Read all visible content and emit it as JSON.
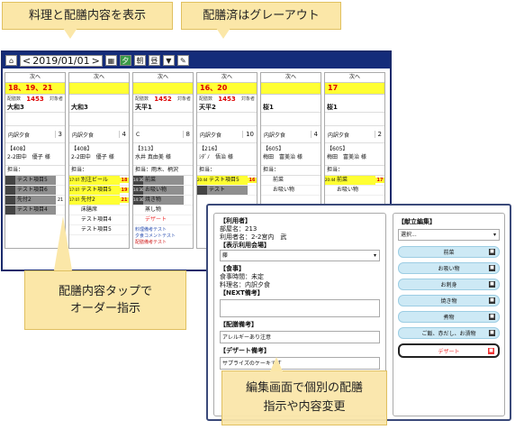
{
  "callouts": {
    "top_left": "料理と配膳内容を表示",
    "top_right": "配膳済はグレーアウト",
    "bottom_left": "配膳内容タップで\nオーダー指示",
    "bottom_right": "編集画面で個別の配膳\n指示や内容変更"
  },
  "toolbar": {
    "home": "⌂",
    "prev": "<",
    "date": "2019/01/01",
    "next": ">",
    "calendar": "▦",
    "btn1": "夕",
    "btn2": "朝",
    "btn3": "昼",
    "filter": "▼",
    "edit": "✎"
  },
  "columns": [
    {
      "next": "次へ",
      "time": "18、19、21",
      "stat_l": "配膳数",
      "num": "1453",
      "stat_r": "対象者",
      "room": "大和3",
      "meal": "内訳夕食",
      "count": "3",
      "inner": "【408】\n2-2田中　優子 様",
      "staff": "担当：",
      "items": [
        {
          "t": "",
          "x": "テスト項目5",
          "q": "",
          "s": "grey"
        },
        {
          "t": "",
          "x": "テスト項目6",
          "q": "",
          "s": "grey"
        },
        {
          "t": "",
          "x": "先付2",
          "q": "21",
          "s": "grey"
        },
        {
          "t": "",
          "x": "テスト項目4",
          "q": "",
          "s": "grey"
        }
      ],
      "notes": []
    },
    {
      "next": "次へ",
      "time": "",
      "stat_l": "",
      "num": "",
      "stat_r": "",
      "room": "大和3",
      "meal": "内訳夕食",
      "count": "4",
      "inner": "【408】\n2-2田中　優子 様",
      "staff": "担当：",
      "items": [
        {
          "t": "17:07",
          "x": "別注ビール",
          "q": "18",
          "s": "yel"
        },
        {
          "t": "17:07",
          "x": "テスト項目5",
          "q": "19",
          "s": "yel"
        },
        {
          "t": "17:07",
          "x": "先付2",
          "q": "21",
          "s": "yel"
        },
        {
          "t": "",
          "x": "床膳席",
          "q": "",
          "s": ""
        },
        {
          "t": "",
          "x": "テスト項目4",
          "q": "",
          "s": ""
        },
        {
          "t": "",
          "x": "テスト項目5",
          "q": "",
          "s": ""
        }
      ],
      "notes": []
    },
    {
      "next": "次へ",
      "time": "",
      "stat_l": "配膳数",
      "num": "1452",
      "stat_r": "対象者",
      "room": "天平1",
      "meal": "C",
      "count": "8",
      "inner": "【313】\n水井 真由美 様",
      "staff": "担当：雨木、柄沢",
      "items": [
        {
          "t": "14:30",
          "x": "前菜",
          "q": "",
          "s": "grey"
        },
        {
          "t": "14:30",
          "x": "お吸い物",
          "q": "",
          "s": "grey"
        },
        {
          "t": "14:30",
          "x": "焼き物",
          "q": "",
          "s": "grey"
        },
        {
          "t": "",
          "x": "蒸し物",
          "q": "",
          "s": ""
        },
        {
          "t": "",
          "x": "デザート",
          "q": "",
          "s": "red"
        }
      ],
      "notes": [
        "料理備考テスト",
        "夕食コメントテスト",
        "配膳備考テスト"
      ]
    },
    {
      "next": "次へ",
      "time": "16、20",
      "stat_l": "配膳数",
      "num": "1453",
      "stat_r": "対象者",
      "room": "天平2",
      "meal": "内訳夕食",
      "count": "10",
      "inner": "【216】\nｼﾀﾞﾉ　悟治 様",
      "staff": "担当：",
      "items": [
        {
          "t": "20:44",
          "x": "テスト項目5",
          "q": "16",
          "s": "yel"
        },
        {
          "t": "",
          "x": "テスト",
          "q": "",
          "s": "grey"
        }
      ],
      "notes": []
    },
    {
      "next": "次へ",
      "time": "",
      "stat_l": "",
      "num": "",
      "stat_r": "",
      "room": "桜1",
      "meal": "内訳夕食",
      "count": "4",
      "inner": "【605】\n梅田　富美治 様",
      "staff": "担当：",
      "items": [
        {
          "t": "",
          "x": "前菜",
          "q": "",
          "s": ""
        },
        {
          "t": "",
          "x": "お吸い物",
          "q": "",
          "s": ""
        }
      ],
      "notes": []
    },
    {
      "next": "次へ",
      "time": "17",
      "stat_l": "",
      "num": "",
      "stat_r": "",
      "room": "桜1",
      "meal": "内訳夕食",
      "count": "2",
      "inner": "【605】\n梅田　富美治 様",
      "staff": "担当：",
      "items": [
        {
          "t": "20:44",
          "x": "前菜",
          "q": "17",
          "s": "yel"
        },
        {
          "t": "",
          "x": "お吸い物",
          "q": "",
          "s": ""
        }
      ],
      "notes": []
    }
  ],
  "edit": {
    "user_h": "【利用者】",
    "room": "部屋名：213",
    "user": "利用者名：2-2宮内　武",
    "venue_h": "【表示利用会場】",
    "venue": "藤",
    "meal_h": "【食事】",
    "meal_time": "食事時間：未定",
    "cook": "料理名：内訳夕食",
    "next_h": "【NEXT備考】",
    "next": "",
    "serve_h": "【配膳備考】",
    "serve": "アレルギーあり注意",
    "dessert_h": "【デザート備考】",
    "dessert": "サプライズのケーキです",
    "menu_h": "【献立編集】",
    "menu_sel": "選択...",
    "menu": [
      "前菜",
      "お吸い物",
      "お刺身",
      "焼き物",
      "煮物",
      "ご飯、赤だし、お漬物",
      "デザート"
    ]
  }
}
